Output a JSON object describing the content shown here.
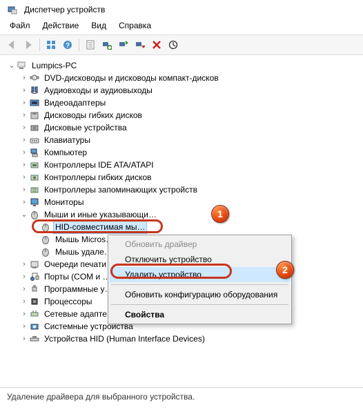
{
  "window": {
    "title": "Диспетчер устройств"
  },
  "menu": {
    "file": "Файл",
    "action": "Действие",
    "view": "Вид",
    "help": "Справка"
  },
  "tree": {
    "root": "Lumpics-PC",
    "items": [
      "DVD-дисководы и дисководы компакт-дисков",
      "Аудиовходы и аудиовыходы",
      "Видеоадаптеры",
      "Дисководы гибких дисков",
      "Дисковые устройства",
      "Клавиатуры",
      "Компьютер",
      "Контроллеры IDE ATA/ATAPI",
      "Контроллеры гибких дисков",
      "Контроллеры запоминающих устройств",
      "Мониторы"
    ],
    "mouse_cat": "Мыши и иные указывающи…",
    "mouse_children": [
      "HID-совместимая мы…",
      "Мышь Micros…",
      "Мышь удале…"
    ],
    "items2": [
      "Очереди печати",
      "Порты (COM и …",
      "Программные у…",
      "Процессоры",
      "Сетевые адапте…",
      "Системные устройства",
      "Устройства HID (Human Interface Devices)"
    ]
  },
  "ctx": {
    "update": "Обновить драйвер",
    "disable": "Отключить устройство",
    "delete": "Удалить устройство",
    "scan": "Обновить конфигурацию оборудования",
    "props": "Свойства"
  },
  "status": "Удаление драйвера для выбранного устройства.",
  "badges": {
    "one": "1",
    "two": "2"
  }
}
